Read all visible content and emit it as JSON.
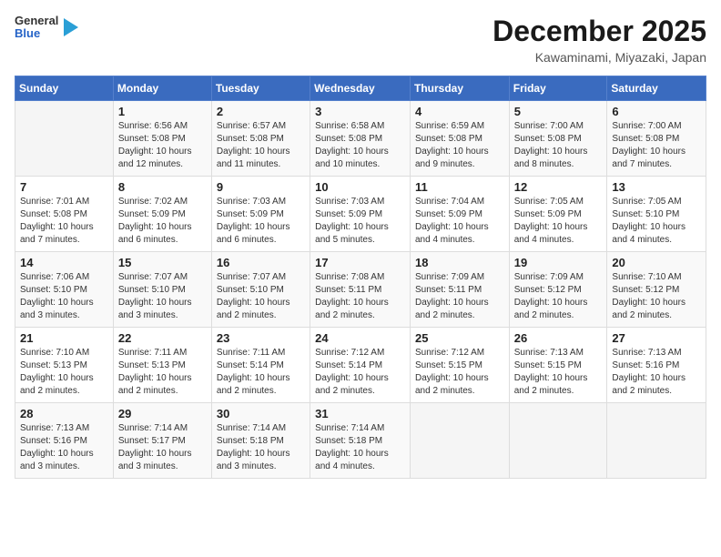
{
  "logo": {
    "general": "General",
    "blue": "Blue"
  },
  "header": {
    "month": "December 2025",
    "location": "Kawaminami, Miyazaki, Japan"
  },
  "weekdays": [
    "Sunday",
    "Monday",
    "Tuesday",
    "Wednesday",
    "Thursday",
    "Friday",
    "Saturday"
  ],
  "weeks": [
    [
      {
        "day": "",
        "info": ""
      },
      {
        "day": "1",
        "info": "Sunrise: 6:56 AM\nSunset: 5:08 PM\nDaylight: 10 hours\nand 12 minutes."
      },
      {
        "day": "2",
        "info": "Sunrise: 6:57 AM\nSunset: 5:08 PM\nDaylight: 10 hours\nand 11 minutes."
      },
      {
        "day": "3",
        "info": "Sunrise: 6:58 AM\nSunset: 5:08 PM\nDaylight: 10 hours\nand 10 minutes."
      },
      {
        "day": "4",
        "info": "Sunrise: 6:59 AM\nSunset: 5:08 PM\nDaylight: 10 hours\nand 9 minutes."
      },
      {
        "day": "5",
        "info": "Sunrise: 7:00 AM\nSunset: 5:08 PM\nDaylight: 10 hours\nand 8 minutes."
      },
      {
        "day": "6",
        "info": "Sunrise: 7:00 AM\nSunset: 5:08 PM\nDaylight: 10 hours\nand 7 minutes."
      }
    ],
    [
      {
        "day": "7",
        "info": "Sunrise: 7:01 AM\nSunset: 5:08 PM\nDaylight: 10 hours\nand 7 minutes."
      },
      {
        "day": "8",
        "info": "Sunrise: 7:02 AM\nSunset: 5:09 PM\nDaylight: 10 hours\nand 6 minutes."
      },
      {
        "day": "9",
        "info": "Sunrise: 7:03 AM\nSunset: 5:09 PM\nDaylight: 10 hours\nand 6 minutes."
      },
      {
        "day": "10",
        "info": "Sunrise: 7:03 AM\nSunset: 5:09 PM\nDaylight: 10 hours\nand 5 minutes."
      },
      {
        "day": "11",
        "info": "Sunrise: 7:04 AM\nSunset: 5:09 PM\nDaylight: 10 hours\nand 4 minutes."
      },
      {
        "day": "12",
        "info": "Sunrise: 7:05 AM\nSunset: 5:09 PM\nDaylight: 10 hours\nand 4 minutes."
      },
      {
        "day": "13",
        "info": "Sunrise: 7:05 AM\nSunset: 5:10 PM\nDaylight: 10 hours\nand 4 minutes."
      }
    ],
    [
      {
        "day": "14",
        "info": "Sunrise: 7:06 AM\nSunset: 5:10 PM\nDaylight: 10 hours\nand 3 minutes."
      },
      {
        "day": "15",
        "info": "Sunrise: 7:07 AM\nSunset: 5:10 PM\nDaylight: 10 hours\nand 3 minutes."
      },
      {
        "day": "16",
        "info": "Sunrise: 7:07 AM\nSunset: 5:10 PM\nDaylight: 10 hours\nand 2 minutes."
      },
      {
        "day": "17",
        "info": "Sunrise: 7:08 AM\nSunset: 5:11 PM\nDaylight: 10 hours\nand 2 minutes."
      },
      {
        "day": "18",
        "info": "Sunrise: 7:09 AM\nSunset: 5:11 PM\nDaylight: 10 hours\nand 2 minutes."
      },
      {
        "day": "19",
        "info": "Sunrise: 7:09 AM\nSunset: 5:12 PM\nDaylight: 10 hours\nand 2 minutes."
      },
      {
        "day": "20",
        "info": "Sunrise: 7:10 AM\nSunset: 5:12 PM\nDaylight: 10 hours\nand 2 minutes."
      }
    ],
    [
      {
        "day": "21",
        "info": "Sunrise: 7:10 AM\nSunset: 5:13 PM\nDaylight: 10 hours\nand 2 minutes."
      },
      {
        "day": "22",
        "info": "Sunrise: 7:11 AM\nSunset: 5:13 PM\nDaylight: 10 hours\nand 2 minutes."
      },
      {
        "day": "23",
        "info": "Sunrise: 7:11 AM\nSunset: 5:14 PM\nDaylight: 10 hours\nand 2 minutes."
      },
      {
        "day": "24",
        "info": "Sunrise: 7:12 AM\nSunset: 5:14 PM\nDaylight: 10 hours\nand 2 minutes."
      },
      {
        "day": "25",
        "info": "Sunrise: 7:12 AM\nSunset: 5:15 PM\nDaylight: 10 hours\nand 2 minutes."
      },
      {
        "day": "26",
        "info": "Sunrise: 7:13 AM\nSunset: 5:15 PM\nDaylight: 10 hours\nand 2 minutes."
      },
      {
        "day": "27",
        "info": "Sunrise: 7:13 AM\nSunset: 5:16 PM\nDaylight: 10 hours\nand 2 minutes."
      }
    ],
    [
      {
        "day": "28",
        "info": "Sunrise: 7:13 AM\nSunset: 5:16 PM\nDaylight: 10 hours\nand 3 minutes."
      },
      {
        "day": "29",
        "info": "Sunrise: 7:14 AM\nSunset: 5:17 PM\nDaylight: 10 hours\nand 3 minutes."
      },
      {
        "day": "30",
        "info": "Sunrise: 7:14 AM\nSunset: 5:18 PM\nDaylight: 10 hours\nand 3 minutes."
      },
      {
        "day": "31",
        "info": "Sunrise: 7:14 AM\nSunset: 5:18 PM\nDaylight: 10 hours\nand 4 minutes."
      },
      {
        "day": "",
        "info": ""
      },
      {
        "day": "",
        "info": ""
      },
      {
        "day": "",
        "info": ""
      }
    ]
  ]
}
